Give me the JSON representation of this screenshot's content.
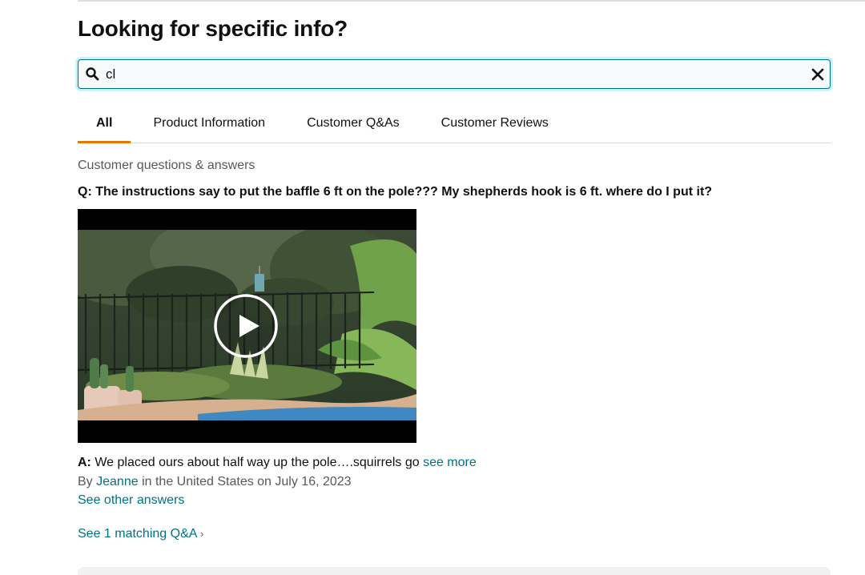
{
  "page": {
    "heading": "Looking for specific info?"
  },
  "search": {
    "value": "cl",
    "placeholder": ""
  },
  "tabs": [
    {
      "label": "All",
      "active": true
    },
    {
      "label": "Product Information",
      "active": false
    },
    {
      "label": "Customer Q&As",
      "active": false
    },
    {
      "label": "Customer Reviews",
      "active": false
    }
  ],
  "qa": {
    "section_label": "Customer questions & answers",
    "question": "Q: The instructions say to put the baffle 6 ft on the pole??? My shepherds hook is 6 ft. where do I put it?",
    "answer_prefix": "A:",
    "answer_text": " We placed ours about half way up the pole….squirrels go ",
    "see_more": "see more",
    "by_prefix": "By ",
    "author": "Jeanne",
    "by_suffix": " in the United States on July 16, 2023",
    "see_other_answers": "See other answers",
    "see_matching": "See 1 matching Q&A",
    "chevron": "›"
  },
  "icons": {
    "search": "search-icon",
    "clear": "close-icon",
    "play": "play-icon"
  },
  "colors": {
    "link": "#007185",
    "tab_active_underline": "#e77600",
    "search_focus": "#c8f3fa"
  }
}
